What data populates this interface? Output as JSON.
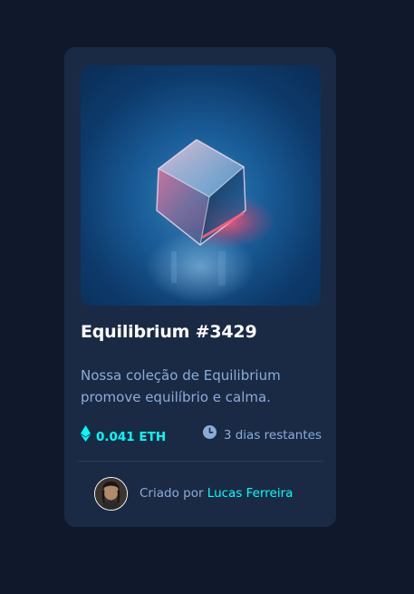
{
  "card": {
    "title": "Equilibrium #3429",
    "description": "Nossa coleção de Equilibrium promove equilíbrio e calma.",
    "price": "0.041 ETH",
    "countdown": "3 dias restantes",
    "creator_prefix": "Criado por",
    "creator_name": "Lucas Ferreira",
    "image_icon": "equilibrium-cube-image",
    "price_icon": "ethereum-icon",
    "countdown_icon": "clock-icon"
  },
  "colors": {
    "page_background": "#0f192b",
    "card_background": "#1b2a44",
    "accent_cyan": "#00fff8",
    "soft_blue": "#8bacd9",
    "white": "#ffffff",
    "divider": "#2e3d55"
  }
}
